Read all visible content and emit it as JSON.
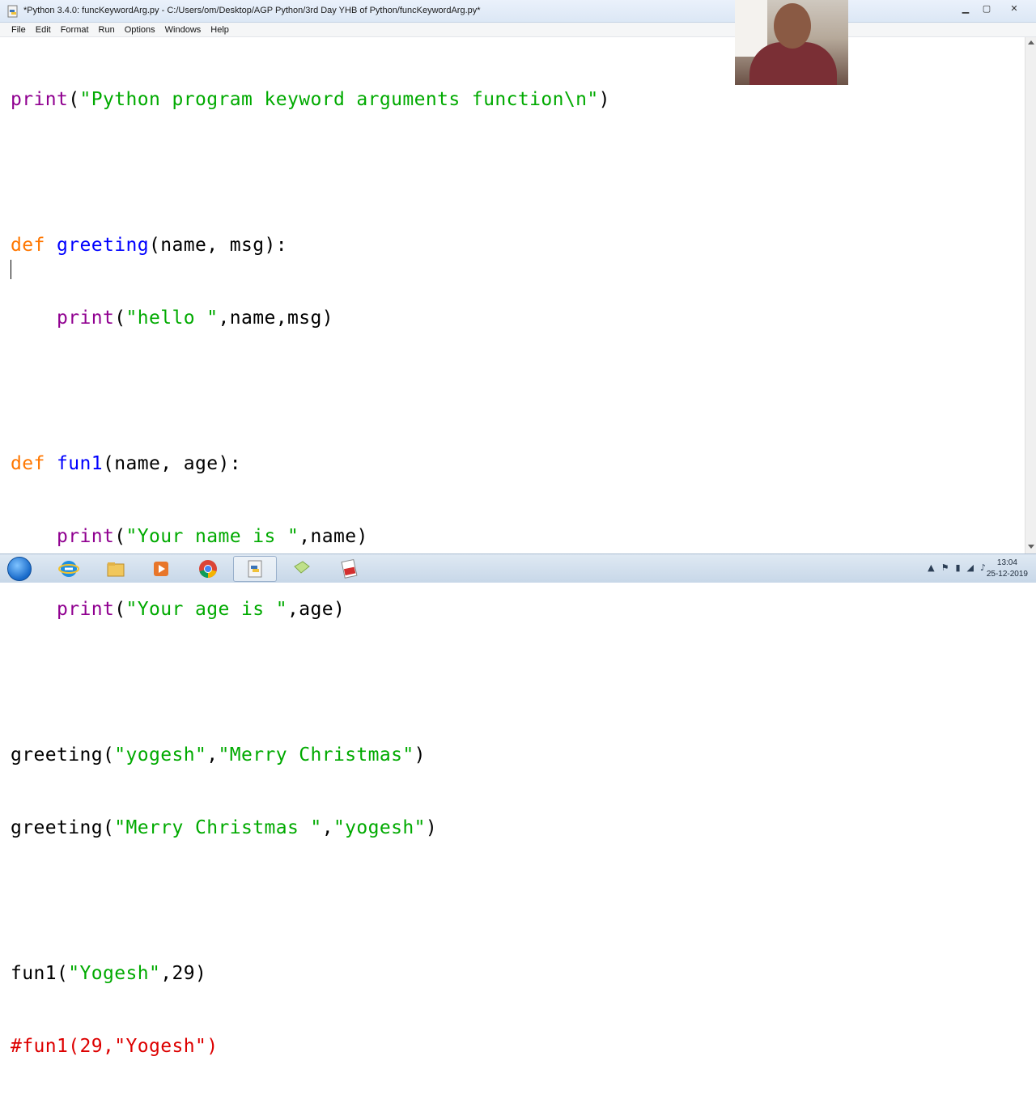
{
  "window": {
    "title": "*Python 3.4.0: funcKeywordArg.py - C:/Users/om/Desktop/AGP Python/3rd Day YHB of Python/funcKeywordArg.py*"
  },
  "menu": [
    "File",
    "Edit",
    "Format",
    "Run",
    "Options",
    "Windows",
    "Help"
  ],
  "code": {
    "l1": {
      "a": "print",
      "b": "(",
      "c": "\"Python program keyword arguments function\\n\"",
      "d": ")"
    },
    "l3": {
      "a": "def",
      "b": " ",
      "c": "greeting",
      "d": "(name, msg):"
    },
    "l4": {
      "a": "    ",
      "b": "print",
      "c": "(",
      "d": "\"hello \"",
      "e": ",name,msg)"
    },
    "l6": {
      "a": "def",
      "b": " ",
      "c": "fun1",
      "d": "(name, age):"
    },
    "l7": {
      "a": "    ",
      "b": "print",
      "c": "(",
      "d": "\"Your name is \"",
      "e": ",name)"
    },
    "l8": {
      "a": "    ",
      "b": "print",
      "c": "(",
      "d": "\"Your age is \"",
      "e": ",age)"
    },
    "l10": {
      "a": "greeting(",
      "b": "\"yogesh\"",
      "c": ",",
      "d": "\"Merry Christmas\"",
      "e": ")"
    },
    "l11": {
      "a": "greeting(",
      "b": "\"Merry Christmas \"",
      "c": ",",
      "d": "\"yogesh\"",
      "e": ")"
    },
    "l13": {
      "a": "fun1(",
      "b": "\"Yogesh\"",
      "c": ",29)"
    },
    "l14": {
      "a": "#fun1(29,\"Yogesh\")"
    }
  },
  "taskbar": {
    "time": "13:04",
    "date": "25-12-2019",
    "apps": [
      "internet-explorer",
      "file-explorer",
      "media-player",
      "chrome",
      "python-idle",
      "notes",
      "pdf"
    ]
  },
  "colors": {
    "keyword": "#ff7700",
    "builtin": "#900090",
    "definition": "#0000ff",
    "string": "#00aa00",
    "comment": "#dd0000"
  }
}
